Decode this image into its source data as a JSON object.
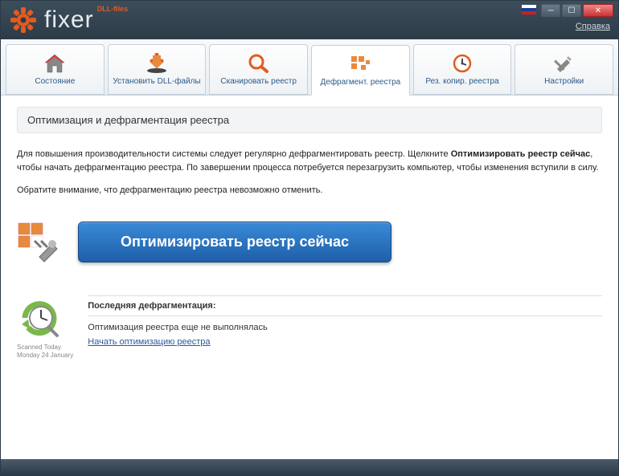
{
  "app": {
    "name": "fixer",
    "superscript": "DLL-files",
    "help_link": "Справка"
  },
  "tabs": [
    {
      "id": "status",
      "label": "Состояние"
    },
    {
      "id": "install",
      "label": "Установить DLL-файлы"
    },
    {
      "id": "scan",
      "label": "Сканировать реестр"
    },
    {
      "id": "defrag",
      "label": "Дефрагмент. реестра",
      "active": true
    },
    {
      "id": "backup",
      "label": "Рез. копир. реестра"
    },
    {
      "id": "settings",
      "label": "Настройки"
    }
  ],
  "section": {
    "title": "Оптимизация и дефрагментация реестра",
    "paragraph1_pre": "Для повышения производительности системы следует регулярно дефрагментировать реестр. Щелкните ",
    "paragraph1_bold": "Оптимизировать реестр сейчас",
    "paragraph1_post": ", чтобы начать дефрагментацию реестра. По завершении процесса потребуется перезагрузить компьютер, чтобы изменения вступили в силу.",
    "paragraph2": "Обратите внимание, что дефрагментацию реестра невозможно отменить.",
    "button_label": "Оптимизировать реестр сейчас"
  },
  "last": {
    "title": "Последняя дефрагментация:",
    "status": "Оптимизация реестра еще не выполнялась",
    "link": "Начать оптимизацию реестра",
    "scan_line1": "Scanned Today",
    "scan_line2": "Monday 24 January"
  },
  "colors": {
    "accent": "#e55a1e",
    "button_top": "#3a8ad8",
    "button_bottom": "#1e5fa8"
  }
}
